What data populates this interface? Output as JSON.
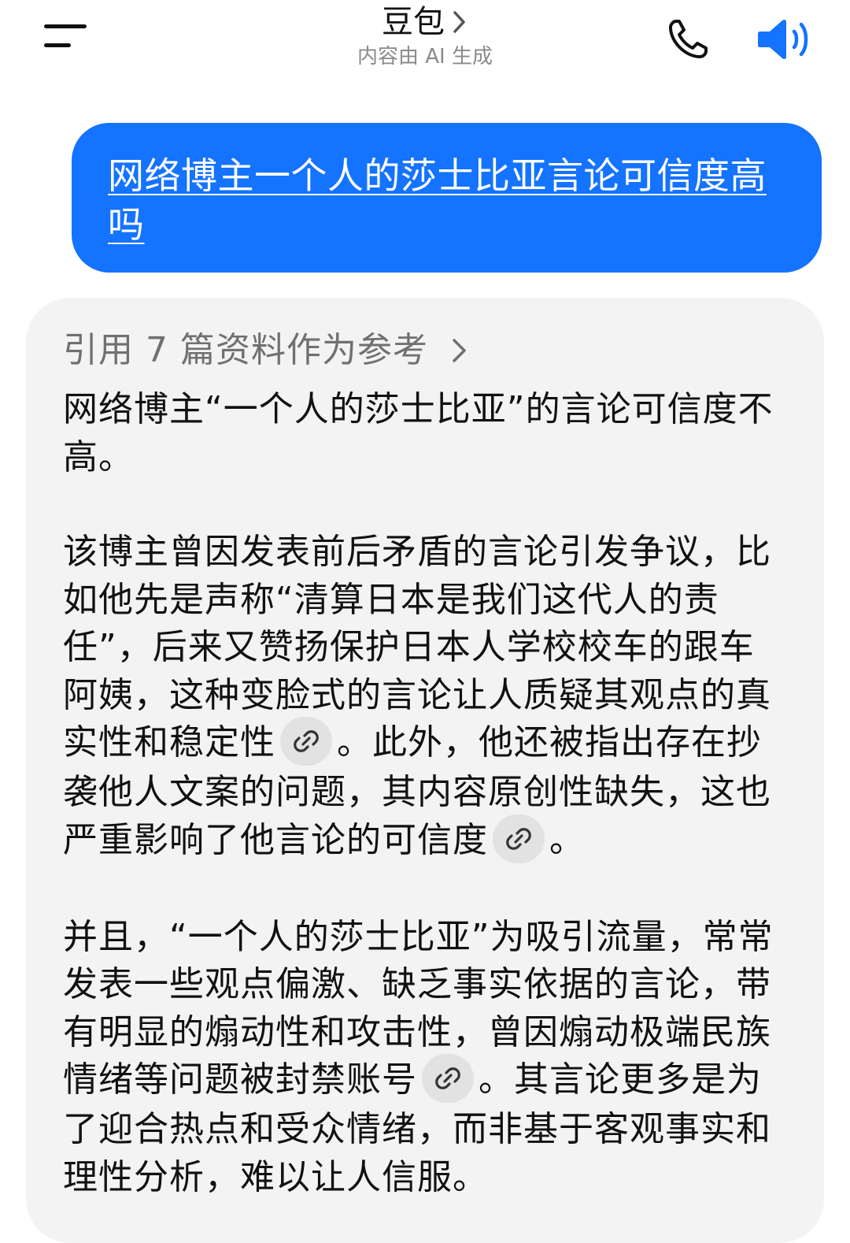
{
  "header": {
    "title": "豆包",
    "subtitle": "内容由 AI 生成",
    "icons": {
      "menu": "menu-icon",
      "title_chevron": "chevron-right-icon",
      "phone": "phone-icon",
      "speaker": "speaker-icon"
    },
    "accent_color": "#1473ff"
  },
  "conversation": {
    "user_message": "网络博主一个人的莎士比亚言论可信度高吗",
    "ai_response": {
      "references_label": "引用 7 篇资料作为参考",
      "paragraph1": "网络博主“一个人的莎士比亚”的言论可信度不高。",
      "paragraph2": {
        "part1": "该博主曾因发表前后矛盾的言论引发争议，比如他先是声称“清算日本是我们这代人的责任”，后来又赞扬保护日本人学校校车的跟车阿姨，这种变脸式的言论让人质疑其观点的真实性和稳定性",
        "part2": "。此外，他还被指出存在抄袭他人文案的问题，其内容原创性缺失，这也严重影响了他言论的可信度",
        "part3": "。"
      },
      "paragraph3": {
        "part1": "并且，“一个人的莎士比亚”为吸引流量，常常发表一些观点偏激、缺乏事实依据的言论，带有明显的煽动性和攻击性，曾因煽动极端民族情绪等问题被封禁账号",
        "part2": "。其言论更多是为了迎合热点和受众情绪，而非基于客观事实和理性分析，难以让人信服。"
      },
      "link_icon": "link-icon"
    }
  }
}
